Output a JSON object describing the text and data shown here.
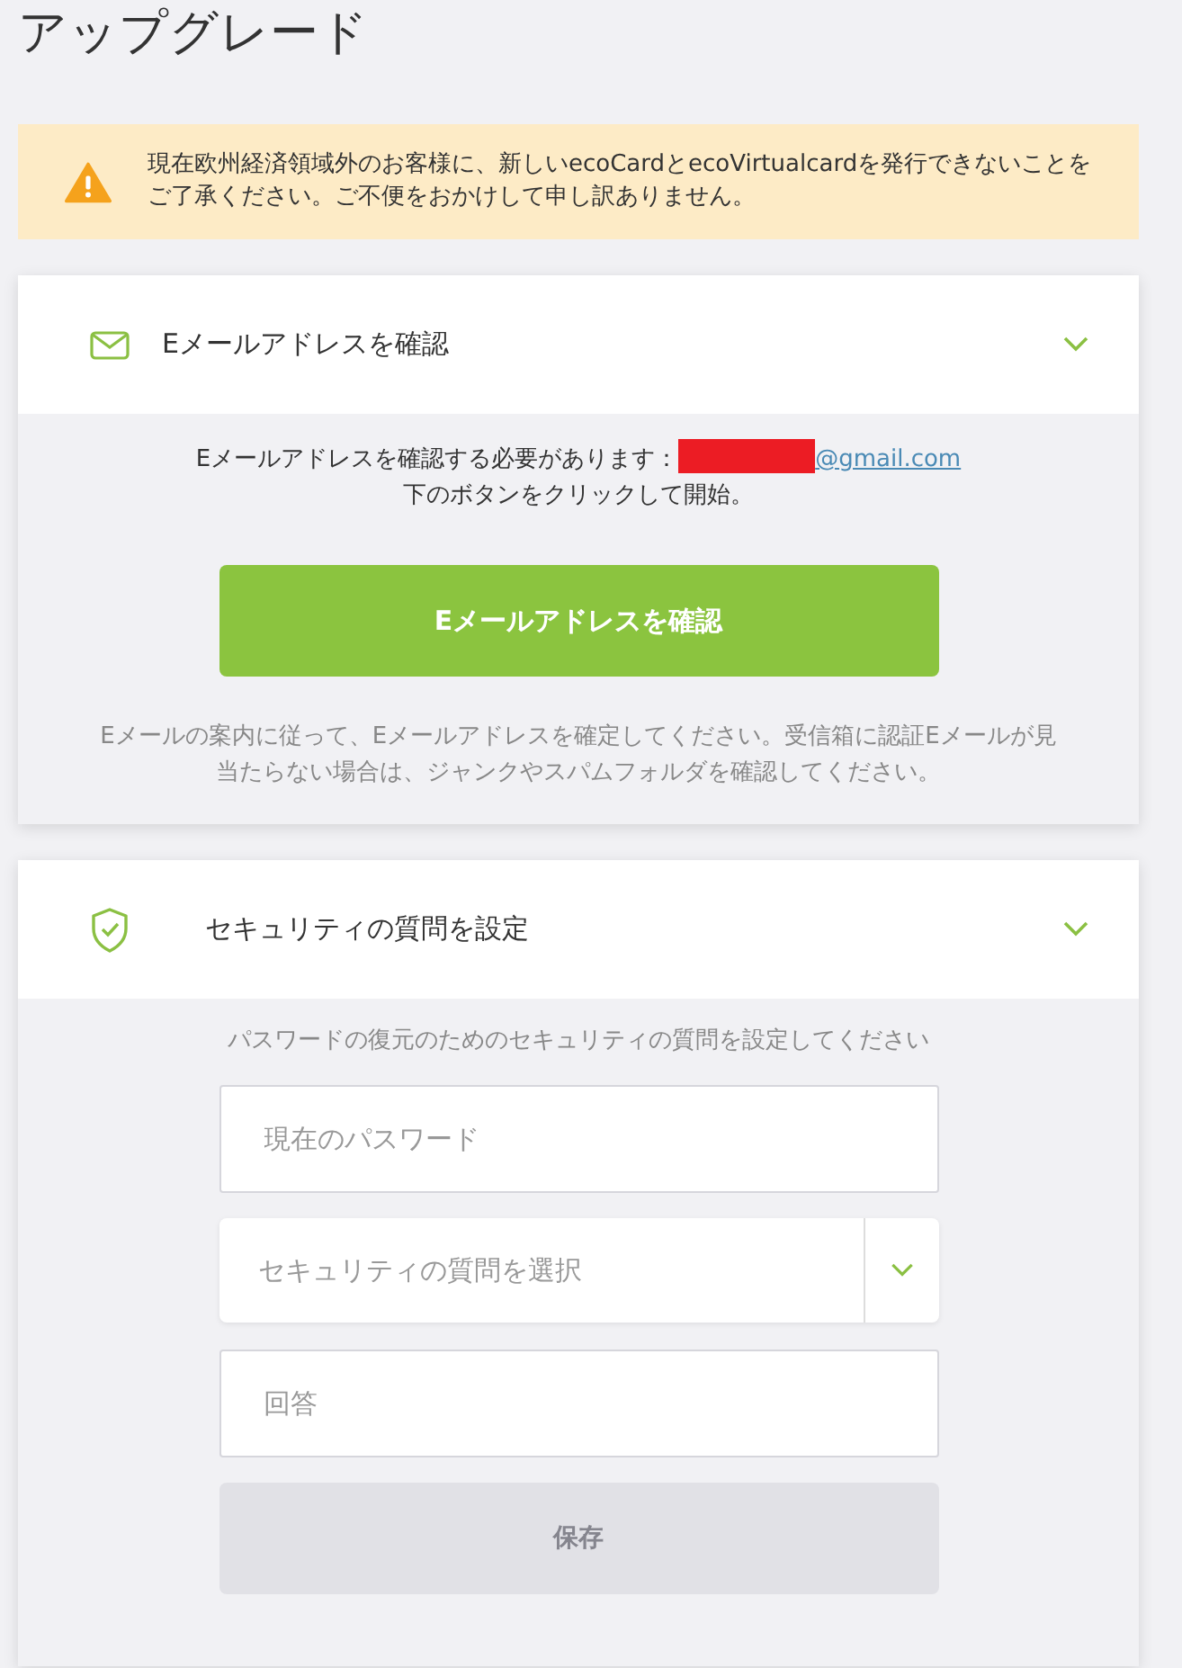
{
  "page": {
    "title": "アップグレード"
  },
  "alert": {
    "text": "現在欧州経済領域外のお客様に、新しいecoCardとecoVirtualcardを発行できないことをご了承ください。ご不便をおかけして申し訳ありません。"
  },
  "email_section": {
    "title": "Eメールアドレスを確認",
    "expanded": true,
    "notice": "Eメールアドレスを確認する必要があります：",
    "email_domain": "@gmail.com",
    "instruction": "下のボタンをクリックして開始。",
    "button": "Eメールアドレスを確認",
    "help": "Eメールの案内に従って、Eメールアドレスを確定してください。受信箱に認証Eメールが見当たらない場合は、ジャンクやスパムフォルダを確認してください。"
  },
  "security_section": {
    "title": "セキュリティの質問を設定",
    "expanded": true,
    "intro": "パスワードの復元のためのセキュリティの質問を設定してください",
    "fields": [
      {
        "kind": "input",
        "placeholder": "現在のパスワード"
      },
      {
        "kind": "select",
        "placeholder": "セキュリティの質問を選択"
      },
      {
        "kind": "input",
        "placeholder": "回答"
      }
    ],
    "button": {
      "label": "保存",
      "disabled": true
    }
  }
}
